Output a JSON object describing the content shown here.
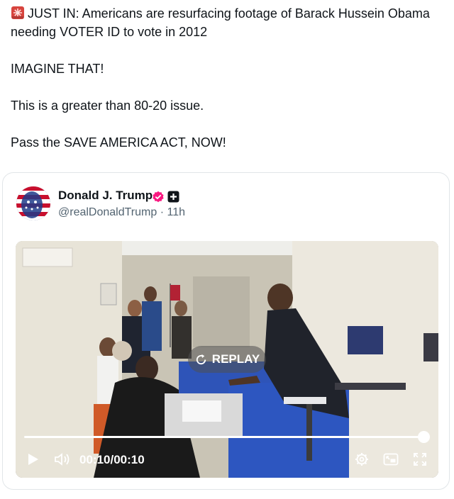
{
  "post": {
    "line1": "JUST IN: Americans are resurfacing footage of Barack Hussein Obama needing VOTER ID to vote in 2012",
    "line2": "IMAGINE THAT!",
    "line3": "This is a greater than 80-20 issue.",
    "line4": "Pass the SAVE AMERICA ACT, NOW!"
  },
  "quoted": {
    "author_name": "Donald J. Trump",
    "handle_time": "@realDonaldTrump · 11h"
  },
  "video": {
    "replay_label": "REPLAY",
    "time_current": "00:10",
    "time_separator": "/",
    "time_total": "00:10",
    "progress": 1.0
  },
  "colors": {
    "accent_pink": "#f91880",
    "progress": "#ffffff"
  },
  "icons": [
    "siren-icon",
    "verified-badge-icon",
    "affiliate-badge-icon",
    "replay-icon",
    "play-icon",
    "volume-icon",
    "settings-icon",
    "pip-icon",
    "fullscreen-icon"
  ]
}
